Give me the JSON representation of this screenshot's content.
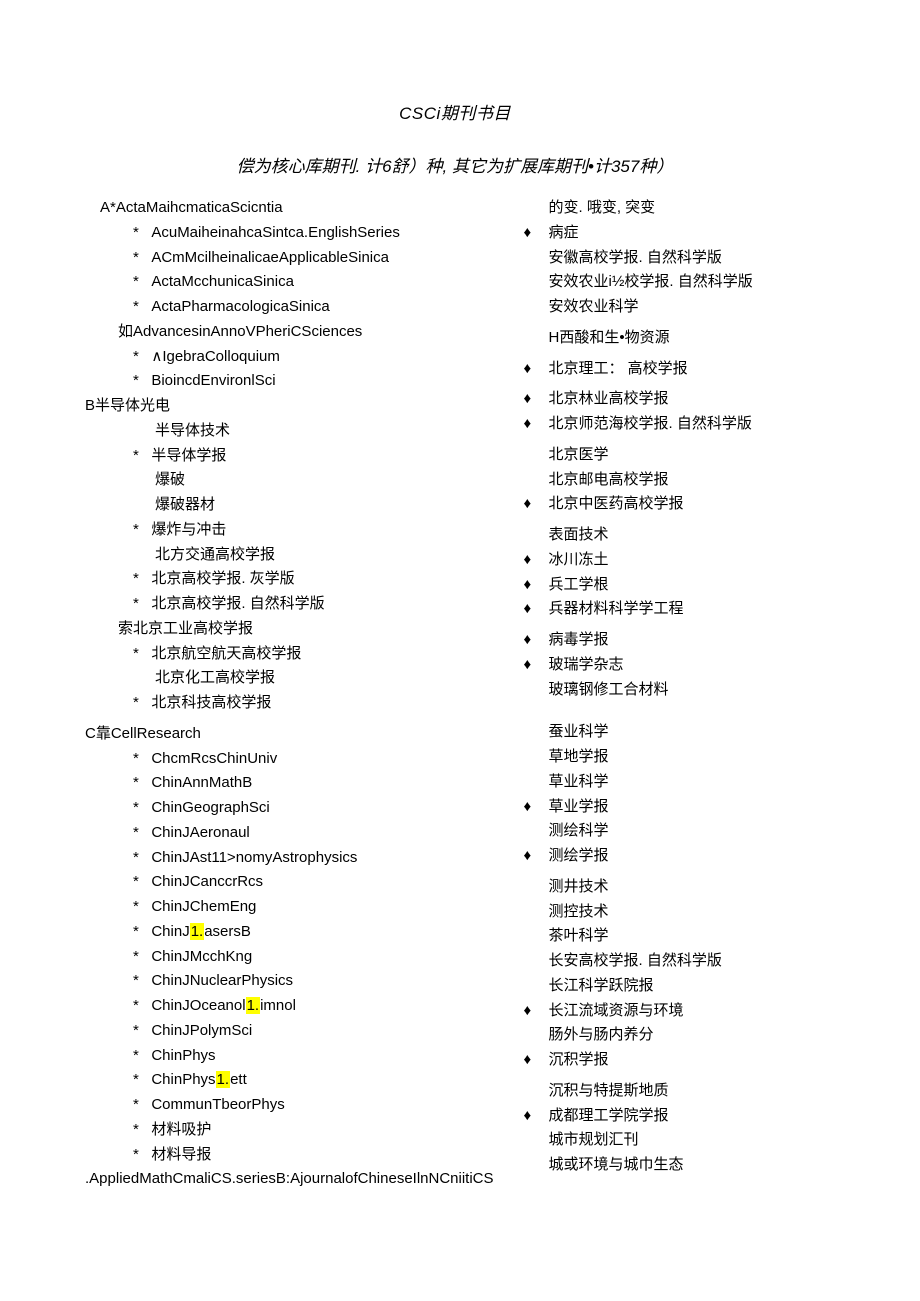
{
  "title_prefix": "CSCi",
  "title_suffix": "期刊书目",
  "subtitle": "偿为核心库期刊. 计6舒）种, 其它为扩展库期刊•计357种）",
  "left": {
    "a_head": "A*ActaMaihcmaticaScicntia",
    "a_items": [
      "AcuMaiheinahcaSintca.EnglishSeries",
      "ACmMcilheinalicaeApplicableSinica",
      "ActaMcchunicaSinica",
      "ActaPharmacologicaSinica"
    ],
    "a_ru": "如AdvancesinAnnoVPheriCSciences",
    "a_items2": [
      "∧IgebraColloquium",
      "BioincdEnvironlSci"
    ],
    "b_head": "B半导体光电",
    "b_line1": "半导体技术",
    "b_star1": "半导体学报",
    "b_line2": "爆破",
    "b_line3": "爆破器材",
    "b_star2": "爆炸与冲击",
    "b_line4": "北方交通高校学报",
    "b_star3": "北京高校学报. 灰学版",
    "b_star4": "北京高校学报. 自然科学版",
    "b_suo": "索北京工业高校学报",
    "b_star5": "北京航空航天高校学报",
    "b_line5": "北京化工高校学报",
    "b_star6": "北京科技高校学报",
    "c_head": "C靠CellResearch",
    "c_items": [
      "ChcmRcsChinUniv",
      "ChinAnnMathB",
      "ChinGeographSci",
      "ChinJAeronaul",
      "ChinJAst11>nomyAstrophysics",
      "ChinJCanccrRcs",
      "ChinJChemEng",
      {
        "pre": "ChinJ",
        "hl": "1.",
        "post": "asersB"
      },
      "ChinJMcchKng",
      "ChinJNuclearPhysics",
      {
        "pre": "ChinJOceanol",
        "hl": "1.",
        "post": "imnol"
      },
      "ChinJPolymSci",
      "ChinPhys",
      {
        "pre": "ChinPhys",
        "hl": "1.",
        "post": "ett"
      },
      "CommunTbeorPhys",
      "材料吸护",
      "材料导报"
    ],
    "dot_line": ".AppliedMathCmaliCS.seriesB:AjournalofChineseIlnNCniitiCS"
  },
  "right": {
    "r1": "的变. 哦变, 突变",
    "r_diam1": "病症",
    "r2": "安徽高校学报. 自然科学版",
    "r3": "安效农业i½校学报. 自然科学版",
    "r4": "安效农业科学",
    "r5": "H西酸和生•物资源",
    "r_diam2": "北京理工： 高校学报",
    "r_diam3": "北京林业高校学报",
    "r_diam4": "北京师范海校学报. 自然科学版",
    "r6": "北京医学",
    "r7": "北京邮电高校学报",
    "r_diam5": "北京中医药高校学报",
    "r8": "表面技术",
    "r_diam6": "冰川冻土",
    "r_diam7": "兵工学根",
    "r_diam8": "兵器材料科学学工程",
    "r_diam9": "病毒学报",
    "r_diam10": "玻瑞学杂志",
    "r9": "玻璃钢修工合材料",
    "r10": "蚕业科学",
    "r11": "草地学报",
    "r12": "草业科学",
    "r_diam11": "草业学报",
    "r13": "测绘科学",
    "r_diam12": "测绘学报",
    "r14": "测井技术",
    "r15": "测控技术",
    "r16": "茶叶科学",
    "r17": "长安高校学报. 自然科学版",
    "r18": "长江科学跃院报",
    "r_diam13": "长江流域资源与环境",
    "r19": "肠外与肠内养分",
    "r_diam14": "沉积学报",
    "r20": "沉积与特提斯地质",
    "r_diam15": "成都理工学院学报",
    "r21": "城市规划汇刊",
    "r22": "城或环境与城巾生态"
  }
}
